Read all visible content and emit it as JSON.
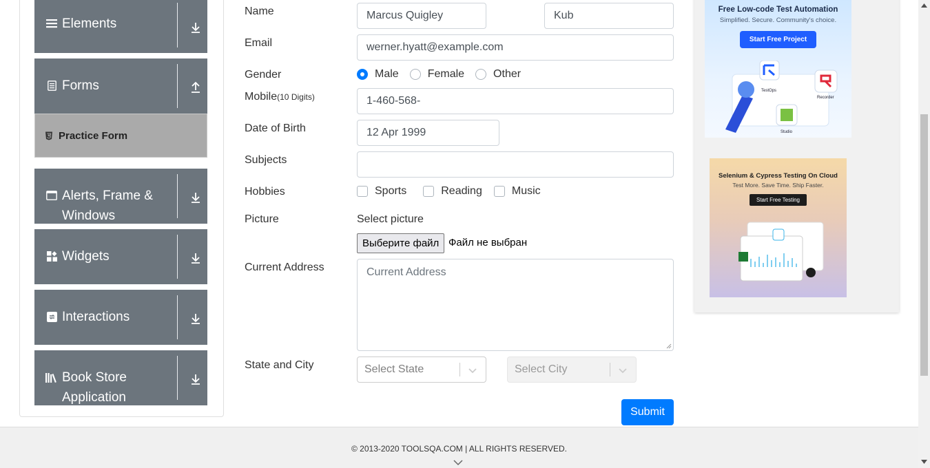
{
  "sidebar": {
    "groups": [
      {
        "label": "Elements",
        "icon": "list-icon",
        "arrow": "down"
      },
      {
        "label": "Forms",
        "icon": "document-icon",
        "arrow": "up"
      },
      {
        "label": "Alerts, Frame & Windows",
        "icon": "window-icon",
        "arrow": "down"
      },
      {
        "label": "Widgets",
        "icon": "widgets-icon",
        "arrow": "down"
      },
      {
        "label": "Interactions",
        "icon": "interactions-icon",
        "arrow": "down"
      },
      {
        "label": "Book Store Application",
        "icon": "books-icon",
        "arrow": "down"
      }
    ],
    "active_item": "Practice Form"
  },
  "form": {
    "name_label": "Name",
    "first_name": "Marcus Quigley",
    "last_name": "Kub",
    "email_label": "Email",
    "email": "werner.hyatt@example.com",
    "gender_label": "Gender",
    "gender_options": [
      "Male",
      "Female",
      "Other"
    ],
    "gender_selected": "Male",
    "mobile_label": "Mobile",
    "mobile_hint": "(10 Digits)",
    "mobile": "1-460-568-",
    "dob_label": "Date of Birth",
    "dob": "12 Apr 1999",
    "subjects_label": "Subjects",
    "subjects": "",
    "hobbies_label": "Hobbies",
    "hobbies": [
      "Sports",
      "Reading",
      "Music"
    ],
    "picture_label": "Picture",
    "select_picture": "Select picture",
    "file_button": "Выберите файл",
    "file_status": "Файл не выбран",
    "address_label": "Current Address",
    "address_placeholder": "Current Address",
    "state_city_label": "State and City",
    "state_placeholder": "Select State",
    "city_placeholder": "Select City",
    "submit": "Submit"
  },
  "ads": {
    "ad1": {
      "headline": "Free Low-code Test Automation",
      "sub": "Simplified. Secure. Community's choice.",
      "button": "Start Free Project",
      "labels": [
        "TestOps",
        "Recorder",
        "Studio"
      ]
    },
    "ad2": {
      "headline": "Selenium & Cypress Testing On Cloud",
      "sub": "Test More. Save Time. Ship Faster.",
      "button": "Start Free Testing"
    }
  },
  "footer": {
    "copyright": "© 2013-2020 TOOLSQA.COM | ALL RIGHTS RESERVED."
  },
  "colors": {
    "primary": "#007bff",
    "sidebar_group": "#6c757d",
    "active_item": "#aaaaaa"
  }
}
